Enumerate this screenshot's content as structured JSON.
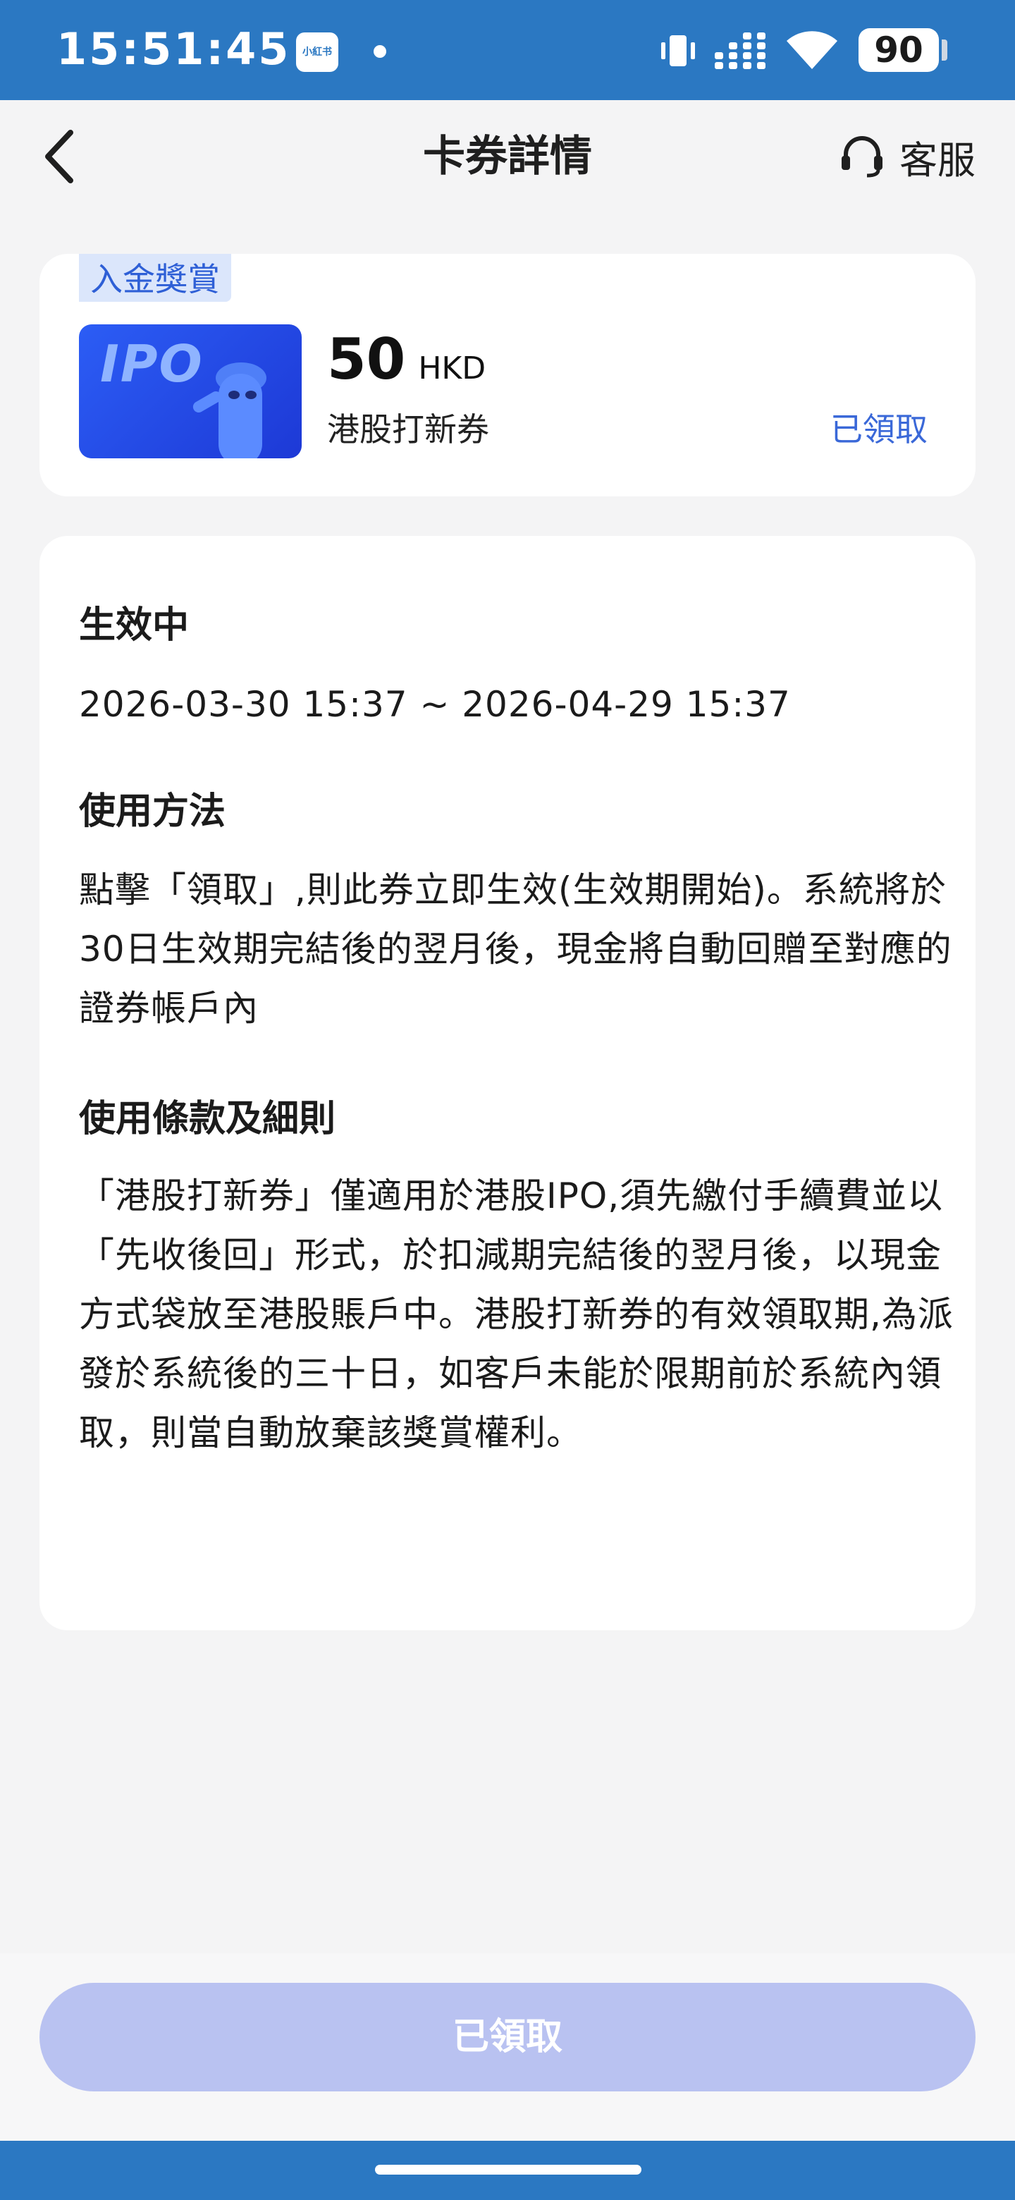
{
  "status_bar": {
    "time": "15:51:45",
    "app_badge": "小紅书",
    "battery": "90"
  },
  "nav": {
    "title": "卡券詳情",
    "service_label": "客服"
  },
  "coupon": {
    "tag": "入金獎賞",
    "image_text": "IPO",
    "amount": "50",
    "currency": "HKD",
    "name": "港股打新券",
    "status": "已領取"
  },
  "detail": {
    "status_title": "生效中",
    "period": "2026-03-30 15:37 ~ 2026-04-29 15:37",
    "usage_title": "使用方法",
    "usage_text": "點擊「領取」,則此券立即生效(生效期開始)。系統將於30日生效期完結後的翌月後，現金將自動回贈至對應的證券帳戶內",
    "terms_title": "使用條款及細則",
    "terms_text": "「港股打新券」僅適用於港股IPO,須先繳付手續費並以「先收後回」形式，於扣減期完結後的翌月後，以現金方式袋放至港股賬戶中。港股打新券的有效領取期,為派發於系統後的三十日，如客戶未能於限期前於系統內領取，則當自動放棄該獎賞權利。"
  },
  "bottom_button": "已領取",
  "colors": {
    "status_bar": "#2b78c2",
    "accent": "#3a68d8",
    "button_disabled": "#b9c2f1",
    "tag_bg": "#dbe6fb"
  }
}
